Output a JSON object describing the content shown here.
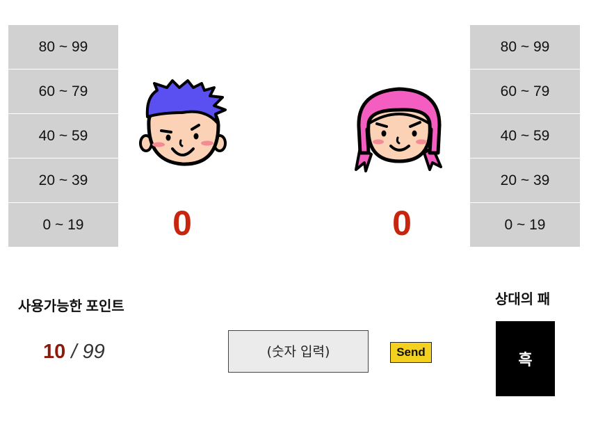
{
  "player1": {
    "ranges": [
      "80 ~ 99",
      "60 ~ 79",
      "40 ~ 59",
      "20 ~ 39",
      "0 ~ 19"
    ],
    "score": "0",
    "avatar_icon": "boy-face-icon",
    "hair_color": "#5a4ff0"
  },
  "player2": {
    "ranges": [
      "80 ~ 99",
      "60 ~ 79",
      "40 ~ 59",
      "20 ~ 39",
      "0 ~ 19"
    ],
    "score": "0",
    "avatar_icon": "girl-face-icon",
    "hair_color": "#f45ec0"
  },
  "points": {
    "label": "사용가능한 포인트",
    "current": "10",
    "separator": "/",
    "max": "99"
  },
  "input": {
    "placeholder": "(숫자 입력)"
  },
  "send_label": "Send",
  "opponent": {
    "label": "상대의 패",
    "card_text": "흑"
  },
  "colors": {
    "score": "#c8250f",
    "points_current": "#8a1a0c",
    "send_button": "#f4d11e",
    "range_cell": "#d1d1d1"
  }
}
